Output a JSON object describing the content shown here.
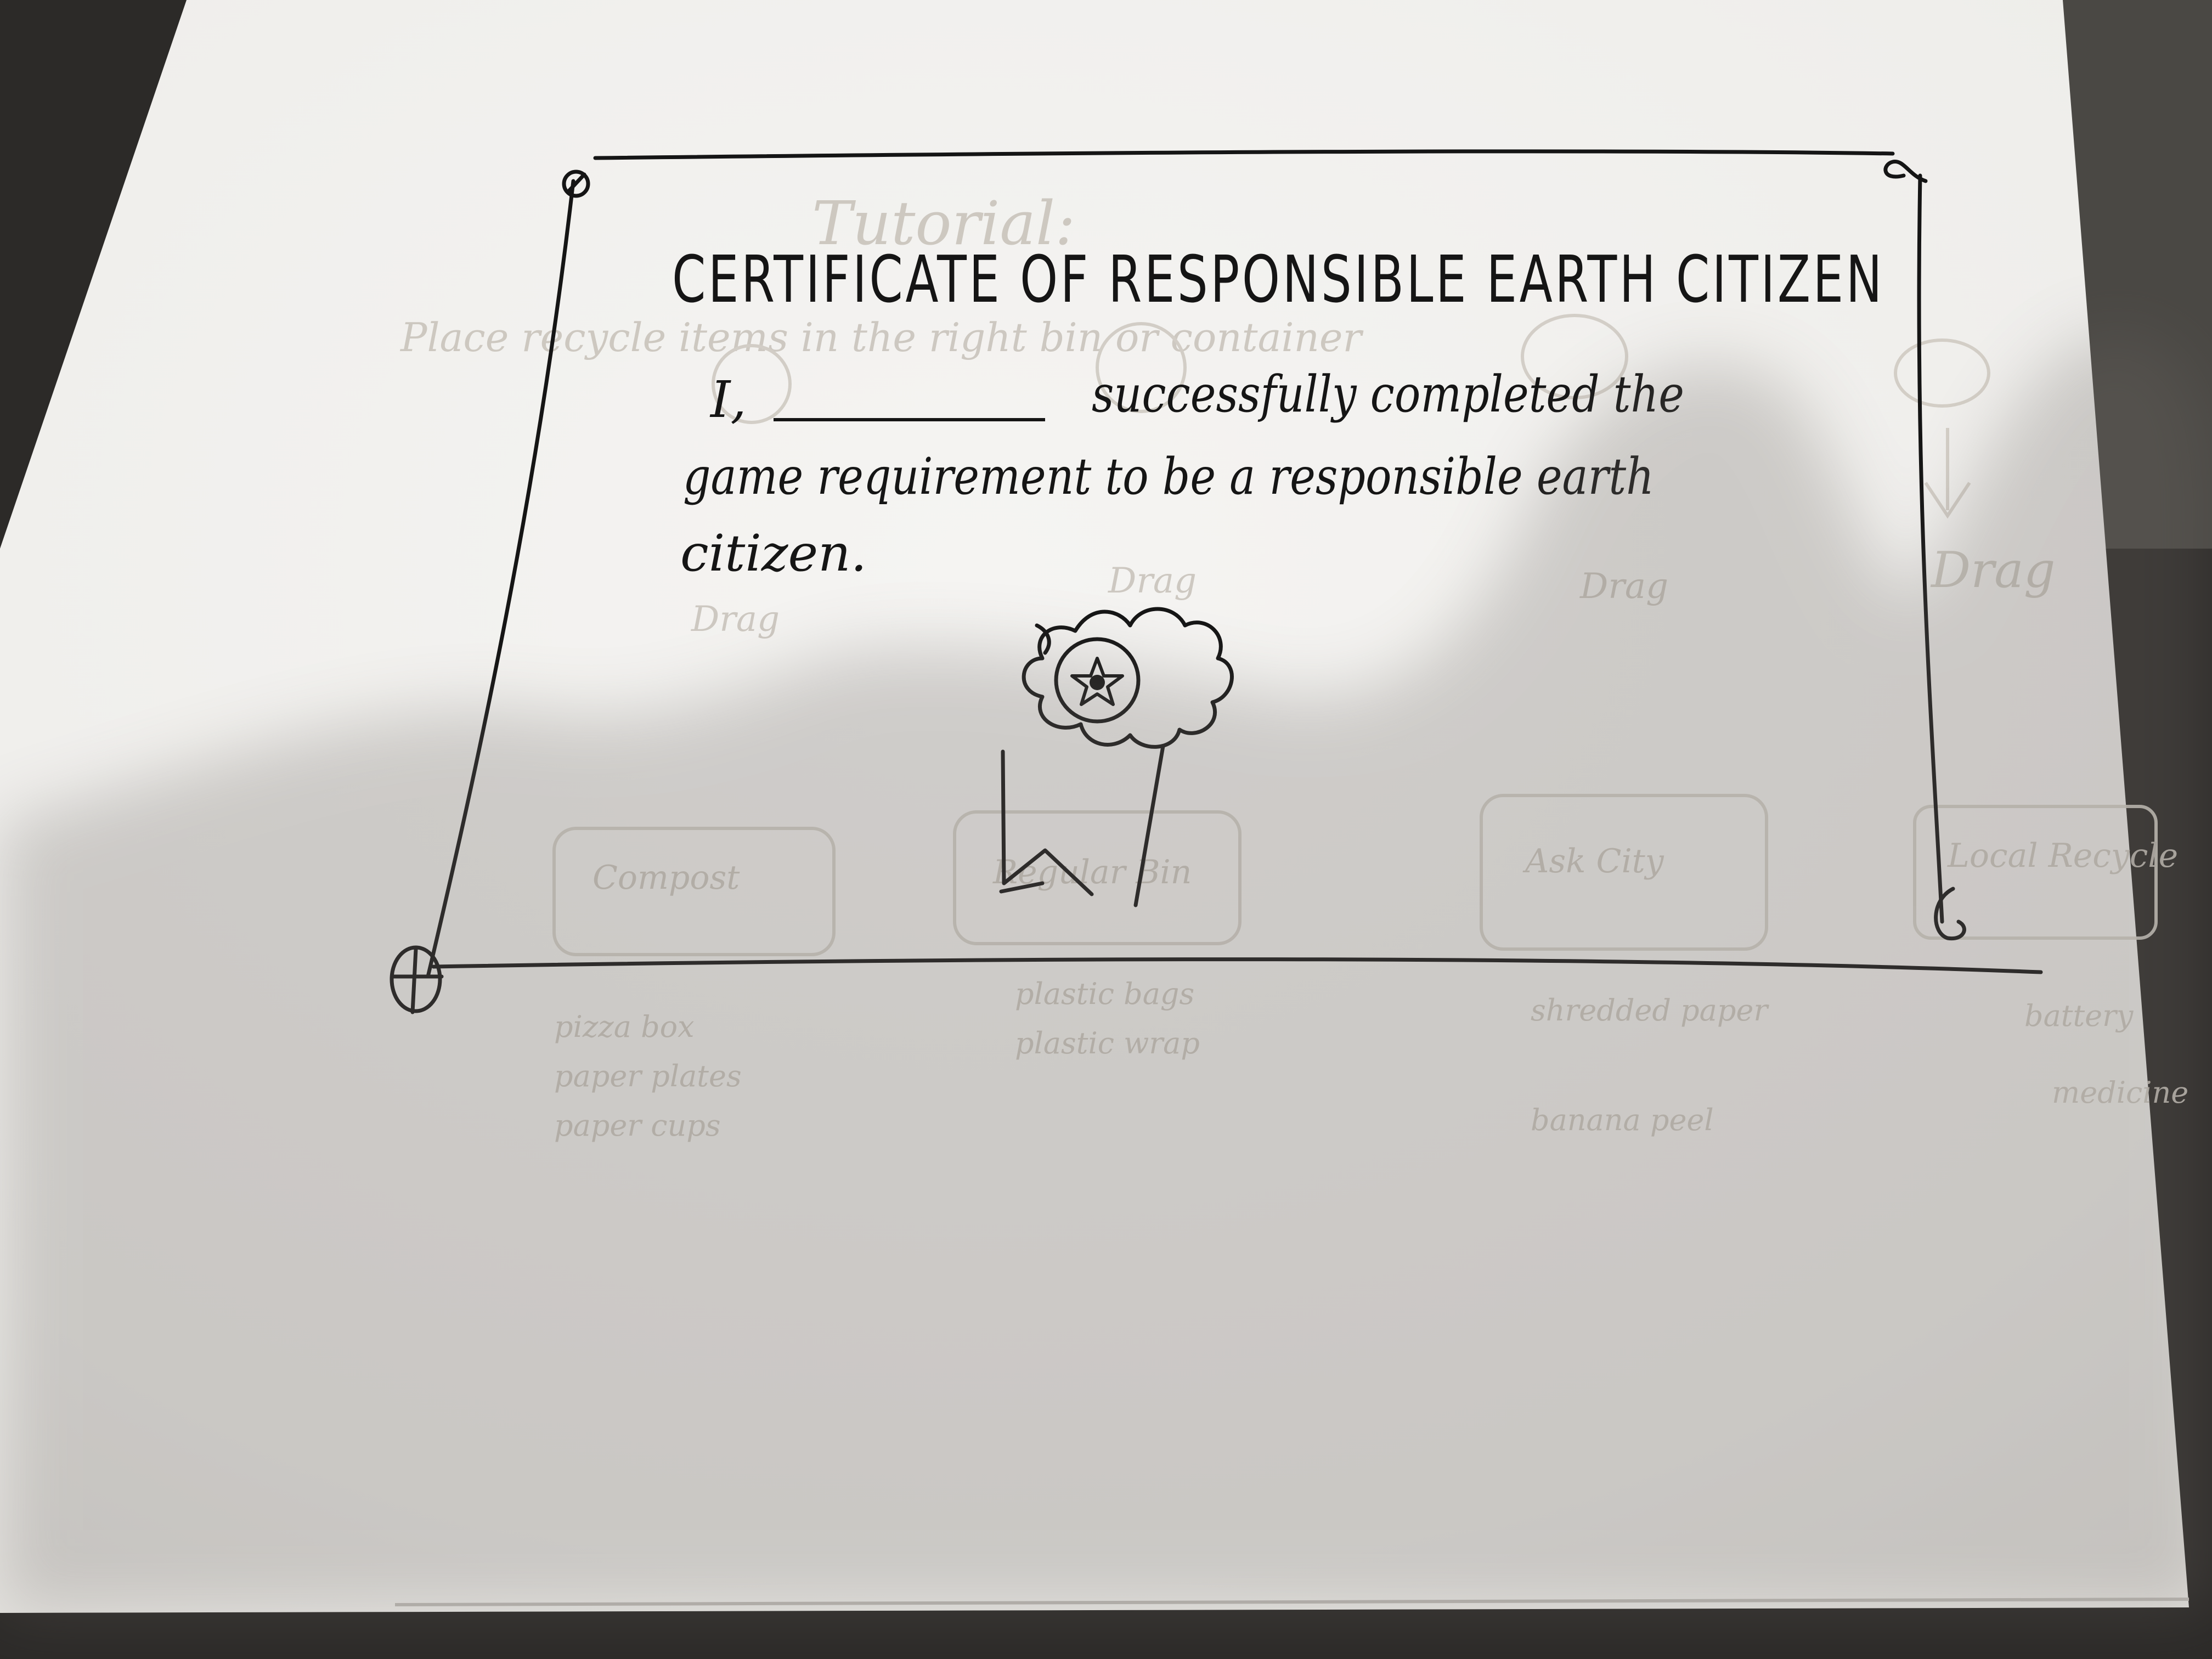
{
  "certificate": {
    "title": "CERTIFICATE OF RESPONSIBLE EARTH CITIZEN",
    "line_1_prefix": "I,",
    "line_1_suffix": "successfully completed the",
    "line_2": "game requirement to be a responsible earth",
    "line_3": "citizen."
  },
  "ghost_sketch": {
    "heading": "Tutorial:",
    "instruction": "Place recycle items in the right bin or container",
    "drag_labels": [
      "Drag",
      "Drag",
      "Drag",
      "Drag"
    ],
    "bins": [
      {
        "label": "Compost",
        "items": [
          "pizza box",
          "paper plates",
          "paper cups"
        ]
      },
      {
        "label": "Regular Bin",
        "items": [
          "plastic bags",
          "plastic wrap"
        ]
      },
      {
        "label": "Ask City",
        "items": [
          "shredded paper",
          "banana peel"
        ]
      },
      {
        "label": "Local Recycle",
        "items": [
          "battery",
          "medicine"
        ]
      }
    ]
  },
  "colors": {
    "ink": "#151515",
    "paper": "#f4f3f1",
    "ghost_ink": "#c9c4bc",
    "table": "#2c2a28"
  },
  "icons": [
    "award-ribbon-icon",
    "star-icon"
  ]
}
